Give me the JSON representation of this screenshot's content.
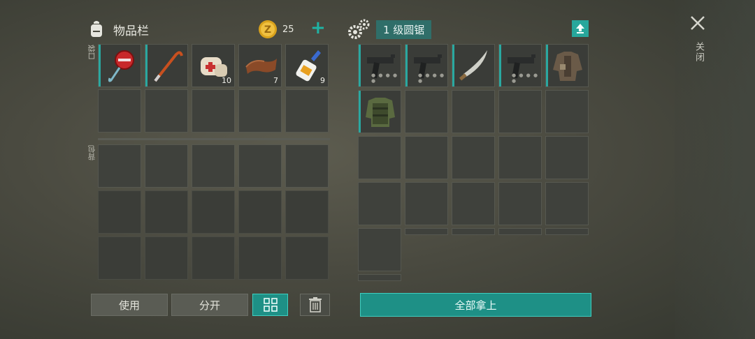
{
  "inventory": {
    "title": "物品栏",
    "coins": "25",
    "plus_icon": "plus-icon",
    "pocket_label": "口袋",
    "backpack_label": "背包",
    "pocket_items": [
      {
        "name": "stop-sign",
        "count": ""
      },
      {
        "name": "crowbar",
        "count": ""
      },
      {
        "name": "bandage",
        "count": "10"
      },
      {
        "name": "leather",
        "count": "7"
      },
      {
        "name": "glue",
        "count": "9"
      }
    ]
  },
  "container": {
    "name": "1 级圆锯",
    "items": [
      {
        "name": "uzi",
        "dots": "● ● ● ● ●"
      },
      {
        "name": "uzi",
        "dots": "● ● ● ● ●"
      },
      {
        "name": "machete",
        "dots": ""
      },
      {
        "name": "uzi",
        "dots": "● ● ● ● ●"
      },
      {
        "name": "jacket",
        "dots": ""
      },
      {
        "name": "armor-vest",
        "dots": ""
      }
    ]
  },
  "close_label": "关闭",
  "buttons": {
    "use": "使用",
    "split": "分开",
    "take_all": "全部拿上"
  },
  "colors": {
    "accent": "#1fb3a4",
    "slot_bar": "#2aa8a0",
    "container_label_bg": "#2f6e69"
  }
}
